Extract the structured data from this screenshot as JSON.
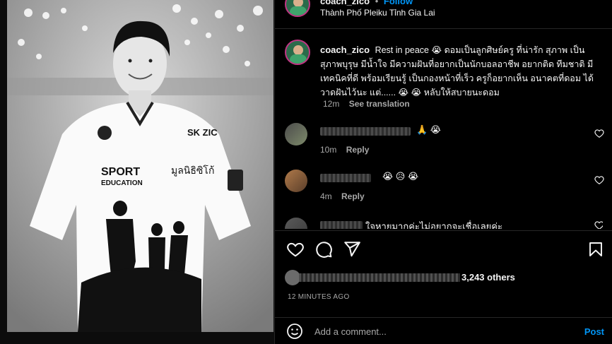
{
  "header": {
    "username": "coach_zico",
    "separator": "•",
    "follow_label": "Follow",
    "location": "Thành Phố Pleiku Tỉnh Gia Lai"
  },
  "photo": {
    "shirt_text_sport": "SPORT",
    "shirt_text_education": "EDUCATION",
    "shirt_brand": "SK ZIC",
    "shirt_thai": "มูลนิธิซิโก้"
  },
  "caption": {
    "username": "coach_zico",
    "text": "Rest in peace 😭 ดอมเป็นลูกศิษย์ครู ที่น่ารัก สุภาพ เป็นสุภาพบุรุษ มีน้ำใจ มีความฝันที่อยากเป็นนักบอลอาชีพ อยากติด ทีมชาติ มีเทคนิคที่ดี พร้อมเรียนรู้ เป็นกองหน้าที่เร็ว ครูก็อยากเห็น อนาคตที่ดอม ได้วาดฝันไว้นะ แต่...... 😭 😭 หลับให้สบายนะดอม",
    "time": "12m",
    "see_translation": "See translation"
  },
  "comments": [
    {
      "text": "🙏 😭",
      "time": "10m",
      "reply": "Reply"
    },
    {
      "text": "😭 😥 😭",
      "time": "4m",
      "reply": "Reply"
    },
    {
      "text": "ใจหายมากค่ะไม่อยากจะเชื่อเลยค่ะ",
      "time": "",
      "reply": ""
    }
  ],
  "likes": {
    "others": "3,243 others"
  },
  "timestamp": "12 MINUTES AGO",
  "add_comment": {
    "placeholder": "Add a comment...",
    "post_label": "Post"
  },
  "colors": {
    "accent": "#0095f6",
    "background": "#000000",
    "text": "#f5f5f5",
    "muted": "#a8a8a8"
  },
  "icons": [
    "heart-icon",
    "comment-icon",
    "share-icon",
    "bookmark-icon",
    "emoji-icon"
  ]
}
